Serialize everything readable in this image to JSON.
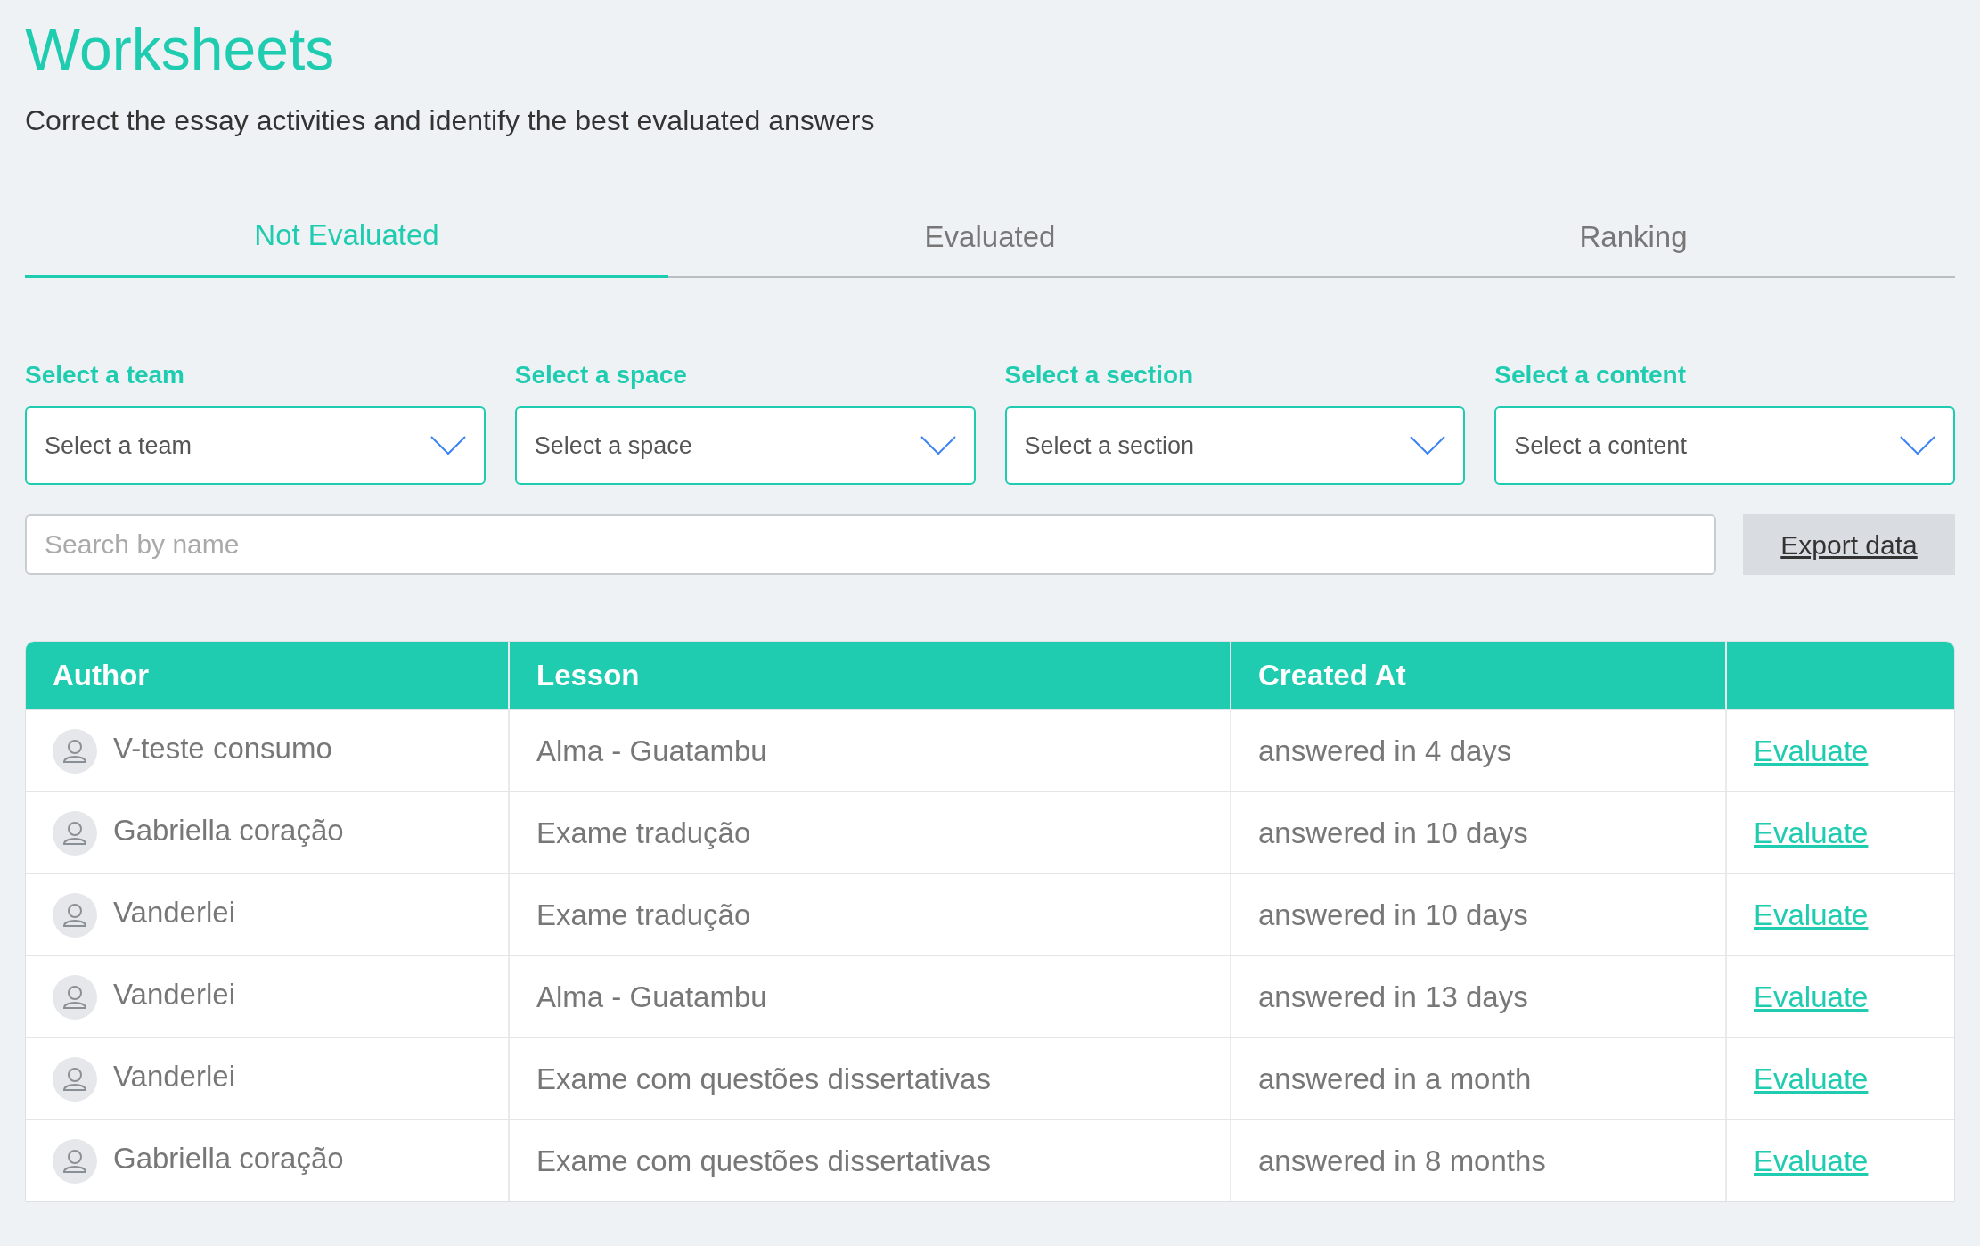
{
  "header": {
    "title": "Worksheets",
    "subtitle": "Correct the essay activities and identify the best evaluated answers"
  },
  "tabs": [
    {
      "label": "Not Evaluated",
      "selected": true
    },
    {
      "label": "Evaluated",
      "selected": false
    },
    {
      "label": "Ranking",
      "selected": false
    }
  ],
  "filters": [
    {
      "label": "Select a team",
      "placeholder": "Select a team"
    },
    {
      "label": "Select a space",
      "placeholder": "Select a space"
    },
    {
      "label": "Select a section",
      "placeholder": "Select a section"
    },
    {
      "label": "Select a content",
      "placeholder": "Select a content"
    }
  ],
  "search": {
    "placeholder": "Search by name"
  },
  "export_button": "Export data",
  "table": {
    "columns": [
      "Author",
      "Lesson",
      "Created At"
    ],
    "rows": [
      {
        "author": "V-teste consumo",
        "lesson": "Alma - Guatambu",
        "created_at": "answered in 4 days",
        "action": "Evaluate"
      },
      {
        "author": "Gabriella coração",
        "lesson": "Exame tradução",
        "created_at": "answered in 10 days",
        "action": "Evaluate"
      },
      {
        "author": "Vanderlei",
        "lesson": "Exame tradução",
        "created_at": "answered in 10 days",
        "action": "Evaluate"
      },
      {
        "author": "Vanderlei",
        "lesson": "Alma - Guatambu",
        "created_at": "answered in 13 days",
        "action": "Evaluate"
      },
      {
        "author": "Vanderlei",
        "lesson": "Exame com questões dissertativas",
        "created_at": "answered in a month",
        "action": "Evaluate"
      },
      {
        "author": "Gabriella coração",
        "lesson": "Exame com questões dissertativas",
        "created_at": "answered in 8 months",
        "action": "Evaluate"
      }
    ]
  }
}
